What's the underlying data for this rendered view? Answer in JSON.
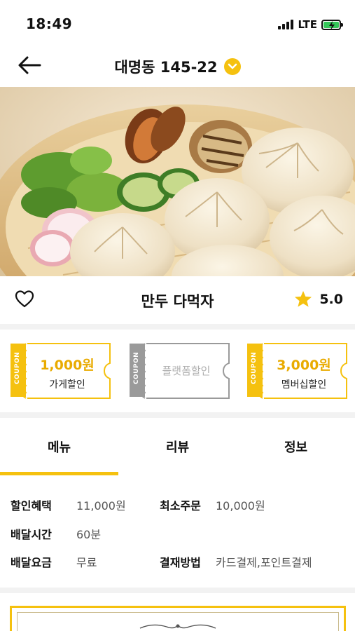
{
  "status": {
    "time": "18:49",
    "network": "LTE"
  },
  "header": {
    "title": "대명동 145-22"
  },
  "store": {
    "name": "만두 다먹자",
    "rating": "5.0"
  },
  "coupons": [
    {
      "stub": "COUPON",
      "amount": "1,000원",
      "label": "가게할인",
      "state": "active",
      "color": "#f5c10f"
    },
    {
      "stub": "COUPON",
      "label": "플랫폼할인",
      "state": "disabled",
      "color": "#9a9a9a"
    },
    {
      "stub": "COUPON",
      "amount": "3,000원",
      "label": "멤버십할인",
      "state": "active",
      "color": "#f5c10f"
    }
  ],
  "tabs": [
    {
      "label": "메뉴",
      "active": true
    },
    {
      "label": "리뷰",
      "active": false
    },
    {
      "label": "정보",
      "active": false
    }
  ],
  "info": {
    "discount": {
      "key": "할인혜택",
      "value": "11,000원"
    },
    "min_order": {
      "key": "최소주문",
      "value": "10,000원"
    },
    "delivery_time": {
      "key": "배달시간",
      "value": "60분"
    },
    "delivery_fee": {
      "key": "배달요금",
      "value": "무료"
    },
    "payment": {
      "key": "결재방법",
      "value": "카드결제,포인트결제"
    }
  },
  "icons": {
    "back": "arrow-left-icon",
    "dropdown": "chevron-down-icon",
    "favorite": "heart-icon",
    "rating": "star-icon"
  },
  "colors": {
    "accent": "#f5c10f",
    "accent_text": "#e9ab00",
    "disabled": "#9a9a9a"
  }
}
